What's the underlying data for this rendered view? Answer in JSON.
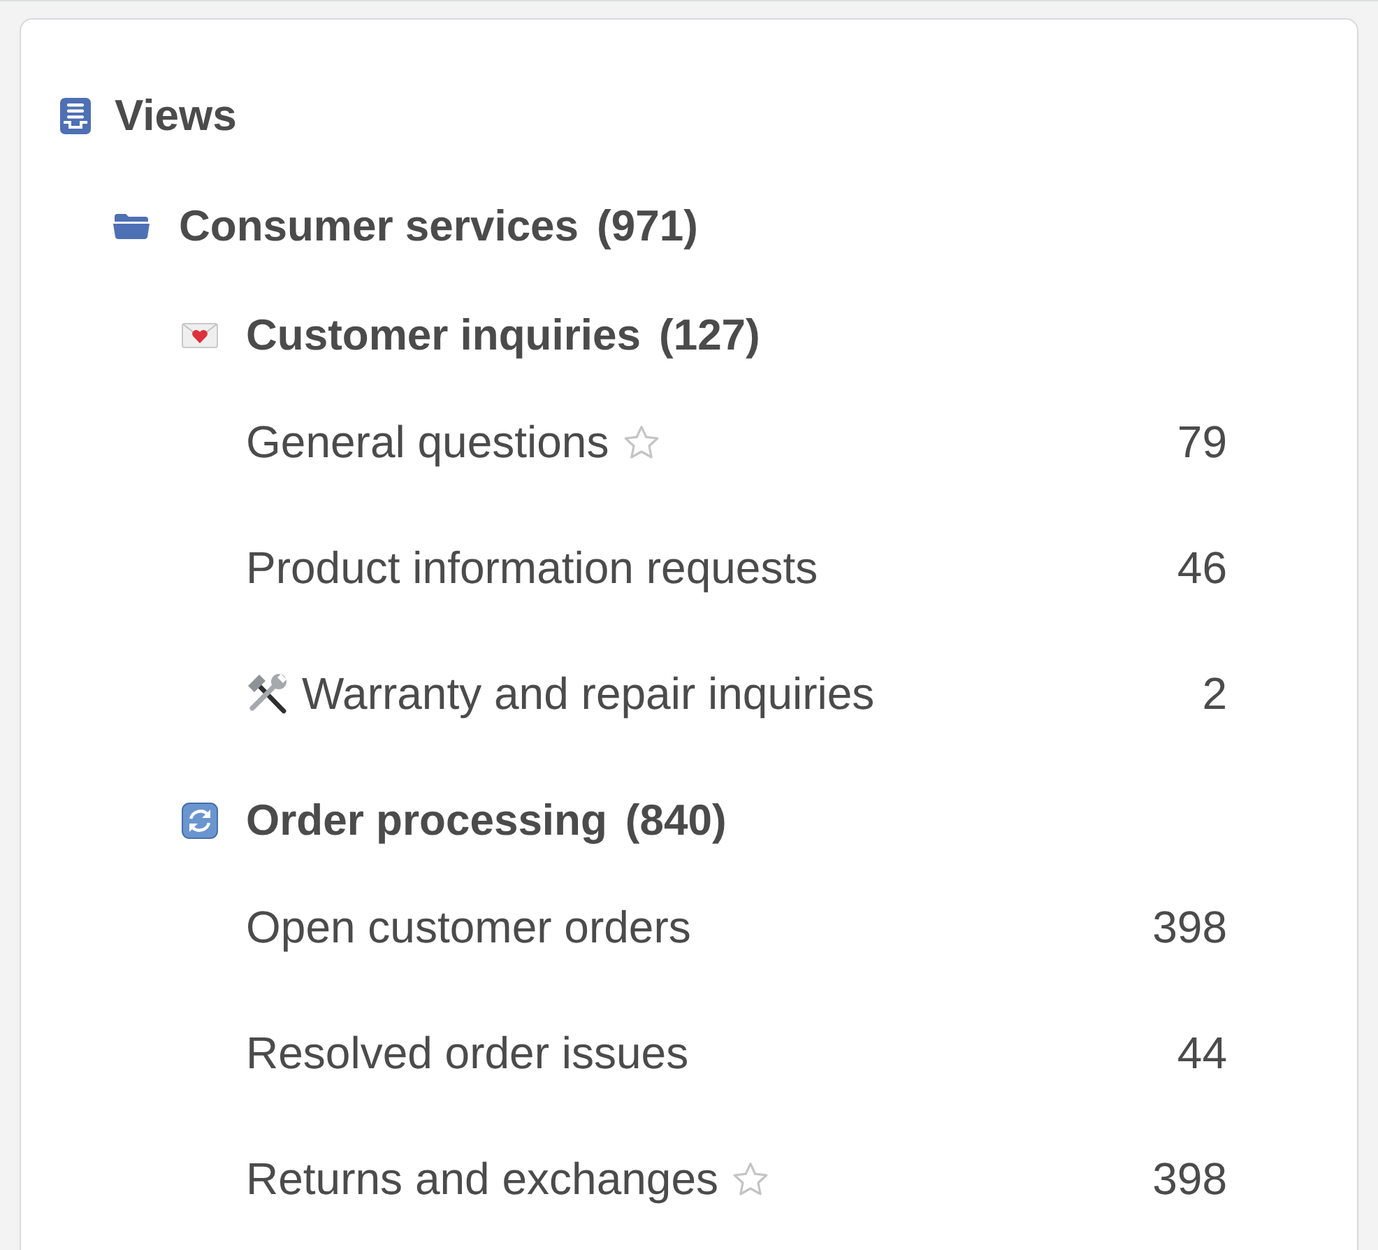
{
  "tree": {
    "title": "Views",
    "children": [
      {
        "name": "Consumer services",
        "count": "(971)",
        "children": [
          {
            "name": "Customer inquiries",
            "count": "(127)",
            "children": [
              {
                "name": "General questions",
                "count": "79",
                "star": true
              },
              {
                "name": "Product information requests",
                "count": "46",
                "star": false
              },
              {
                "name": "Warranty and repair inquiries",
                "count": "2",
                "star": false
              }
            ]
          },
          {
            "name": "Order processing",
            "count": "(840)",
            "children": [
              {
                "name": "Open customer orders",
                "count": "398",
                "star": false
              },
              {
                "name": "Resolved order issues",
                "count": "44",
                "star": false
              },
              {
                "name": "Returns and exchanges",
                "count": "398",
                "star": true
              }
            ]
          }
        ]
      }
    ]
  }
}
